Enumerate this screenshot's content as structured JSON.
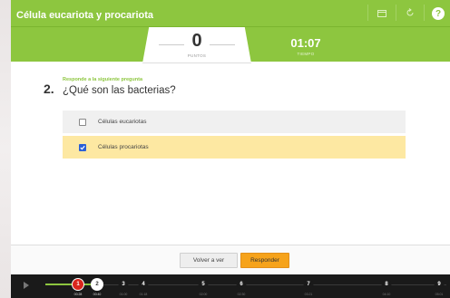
{
  "header": {
    "title": "Célula eucariota y procariota",
    "icons": [
      "calendar-icon",
      "refresh-icon",
      "help-icon"
    ],
    "help_glyph": "?"
  },
  "score": {
    "value": "0",
    "label": "PUNTOS"
  },
  "timer": {
    "value": "01:07",
    "label": "TIEMPO"
  },
  "question": {
    "number": "2.",
    "instruction": "Responde a la siguiente pregunta",
    "text": "¿Qué son las bacterias?",
    "options": [
      {
        "label": "Células eucariotas",
        "checked": false
      },
      {
        "label": "Células procariotas",
        "checked": true
      }
    ]
  },
  "buttons": {
    "back": "Volver a ver",
    "answer": "Responder"
  },
  "timeline": {
    "markers": [
      {
        "num": "1",
        "time": "00:28",
        "state": "done"
      },
      {
        "num": "2",
        "time": "00:40",
        "state": "current"
      },
      {
        "num": "3",
        "time": "01:00",
        "state": "pending"
      },
      {
        "num": "4",
        "time": "01:18",
        "state": "pending"
      },
      {
        "num": "5",
        "time": "02:00",
        "state": "pending"
      },
      {
        "num": "6",
        "time": "02:30",
        "state": "pending"
      },
      {
        "num": "7",
        "time": "03:21",
        "state": "pending"
      },
      {
        "num": "8",
        "time": "04:10",
        "state": "pending"
      },
      {
        "num": "9",
        "time": "05:01",
        "state": "pending"
      }
    ]
  },
  "colors": {
    "header_green": "#8dc63f",
    "selected_option": "#fde8a2",
    "answer_button": "#f6a31b",
    "current_marker": "#d9251c",
    "checkbox_blue": "#2a5fd6"
  }
}
